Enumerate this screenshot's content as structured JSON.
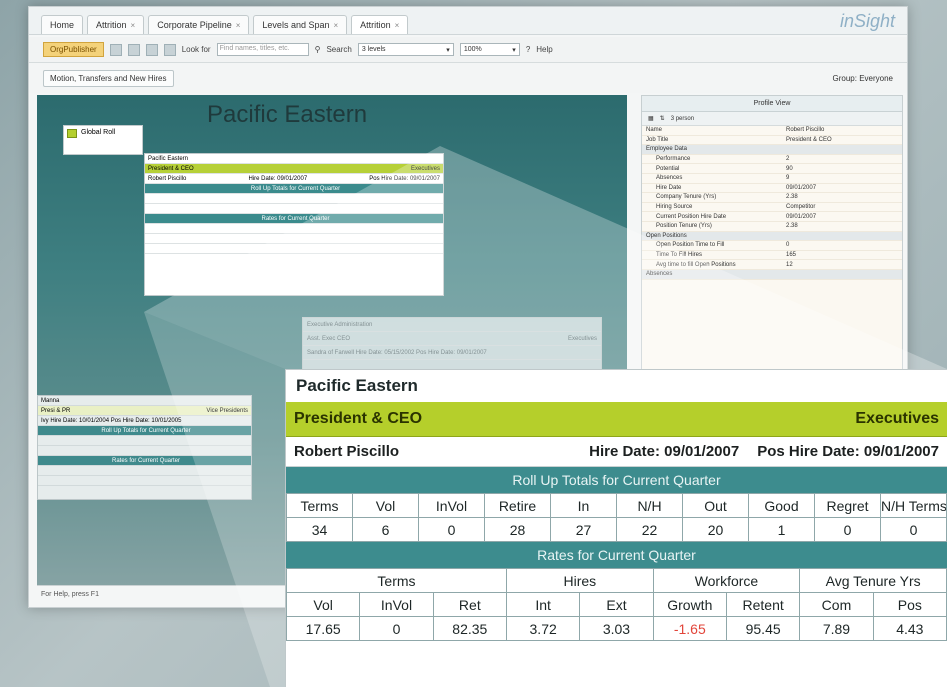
{
  "tabs": [
    {
      "label": "Home",
      "active": false
    },
    {
      "label": "Attrition",
      "active": false
    },
    {
      "label": "Corporate Pipeline",
      "active": false
    },
    {
      "label": "Levels and Span",
      "active": false
    },
    {
      "label": "Attrition",
      "active": true
    }
  ],
  "logo": {
    "text": "inSight"
  },
  "toolbar": {
    "org_button": "OrgPublisher",
    "look_for_label": "Look for",
    "look_for_placeholder": "Find names, titles, etc.",
    "search_label": "Search",
    "levels_value": "3 levels",
    "zoom_value": "100%",
    "help_label": "Help"
  },
  "subbar": {
    "left_button": "Motion, Transfers and New Hires",
    "group_label": "Group: Everyone"
  },
  "canvas": {
    "title": "Pacific Eastern",
    "legend_label": "Global Roll",
    "mini_card": {
      "company": "Pacific Eastern",
      "title": "President & CEO",
      "group": "Executives",
      "employee": "Robert Piscillo",
      "hire": "Hire Date: 09/01/2007",
      "pos_hire": "Pos Hire Date: 09/01/2007",
      "rollup_label": "Roll Up Totals for Current Quarter",
      "rates_label": "Rates for Current Quarter"
    },
    "ghost_card": {
      "line1": "Executive Administration",
      "line2": "Asst. Exec CEO",
      "line2_right": "Executives",
      "line3": "Sandra of Farwell   Hire Date: 05/15/2002   Pos Hire Date: 09/01/2007"
    },
    "left_card": {
      "line1": "Manna",
      "line2": "Presi & PR",
      "line2_right": "Vice Presidents",
      "line3": "Ivy       Hire Date: 10/01/2004   Pos Hire Date: 10/01/2005",
      "band1": "Roll Up Totals for Current Quarter",
      "band2": "Rates for Current Quarter"
    },
    "status": "For Help, press F1"
  },
  "profile": {
    "title": "Profile View",
    "count_label": "3 person",
    "rows": [
      {
        "k": "Name",
        "v": "Robert Piscillo",
        "type": "field"
      },
      {
        "k": "Job Title",
        "v": "President & CEO",
        "type": "field"
      },
      {
        "k": "Employee Data",
        "v": "",
        "type": "group"
      },
      {
        "k": "Performance",
        "v": "2",
        "type": "indent"
      },
      {
        "k": "Potential",
        "v": "90",
        "type": "indent"
      },
      {
        "k": "Absences",
        "v": "9",
        "type": "indent"
      },
      {
        "k": "Hire Date",
        "v": "09/01/2007",
        "type": "indent"
      },
      {
        "k": "Company Tenure (Yrs)",
        "v": "2.38",
        "type": "indent"
      },
      {
        "k": "Hiring Source",
        "v": "Competitor",
        "type": "indent"
      },
      {
        "k": "Current Position Hire Date",
        "v": "09/01/2007",
        "type": "indent"
      },
      {
        "k": "Position Tenure (Yrs)",
        "v": "2.38",
        "type": "indent"
      },
      {
        "k": "Open Positions",
        "v": "",
        "type": "group"
      },
      {
        "k": "Open Position Time to Fill",
        "v": "0",
        "type": "indent"
      },
      {
        "k": "Time To Fill Hires",
        "v": "165",
        "type": "indent"
      },
      {
        "k": "Avg time to fill Open Positions",
        "v": "12",
        "type": "indent"
      },
      {
        "k": "Absences",
        "v": "",
        "type": "group"
      }
    ]
  },
  "zoom": {
    "company": "Pacific Eastern",
    "title": "President & CEO",
    "group": "Executives",
    "employee": "Robert Piscillo",
    "hire_date": "Hire Date: 09/01/2007",
    "pos_hire_date": "Pos Hire Date: 09/01/2007",
    "rollup_label": "Roll Up Totals for Current Quarter",
    "rollup_headers": [
      "Terms",
      "Vol",
      "InVol",
      "Retire",
      "In",
      "N/H",
      "Out",
      "Good",
      "Regret",
      "N/H Terms"
    ],
    "rollup_values": [
      "34",
      "6",
      "0",
      "28",
      "27",
      "22",
      "20",
      "1",
      "0",
      "0"
    ],
    "rates_label": "Rates for Current Quarter",
    "rates_groups": [
      "Terms",
      "Hires",
      "Workforce",
      "Avg Tenure Yrs"
    ],
    "rates_headers": [
      "Vol",
      "InVol",
      "Ret",
      "Int",
      "Ext",
      "Growth",
      "Retent",
      "Com",
      "Pos"
    ],
    "rates_values": [
      "17.65",
      "0",
      "82.35",
      "3.72",
      "3.03",
      "-1.65",
      "95.45",
      "7.89",
      "4.43"
    ],
    "negative_color": "#e2453a",
    "green_color": "#b5cf2b",
    "teal_color": "#3d8c8e"
  }
}
